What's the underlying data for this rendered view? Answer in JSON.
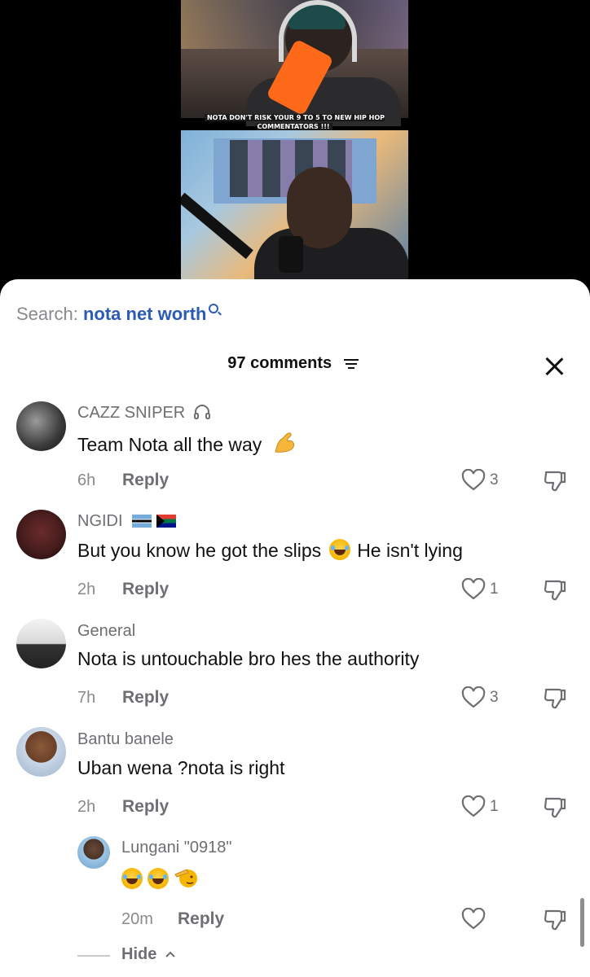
{
  "video": {
    "caption": "NOTA DON'T RISK YOUR 9 TO 5 TO NEW HIP HOP COMMENTATORS !!!"
  },
  "search": {
    "label": "Search:",
    "query": "nota net worth",
    "icon": "search-icon",
    "accent": "#2b5bb5"
  },
  "header": {
    "count": "97 comments",
    "filter_icon": "filter-icon",
    "close_icon": "close-icon"
  },
  "comments": [
    {
      "user": "CAZZ SNIPER",
      "badge": "headphones-icon",
      "text": "Team Nota all the way",
      "emoji": "flexed-biceps",
      "time": "6h",
      "reply": "Reply",
      "likes": "3"
    },
    {
      "user": "NGIDI",
      "badge": "flags-botswana-south-africa",
      "text_a": "But you know he got the slips",
      "emoji": "tears-of-joy",
      "text_b": "He isn't lying",
      "time": "2h",
      "reply": "Reply",
      "likes": "1"
    },
    {
      "user": "General",
      "text": "Nota is untouchable bro hes the authority",
      "time": "7h",
      "reply": "Reply",
      "likes": "3"
    },
    {
      "user": "Bantu banele",
      "text": "Uban wena ?nota is right",
      "time": "2h",
      "reply": "Reply",
      "likes": "1"
    }
  ],
  "nested_reply": {
    "user": "Lungani \"0918\"",
    "emojis": [
      "tears-of-joy",
      "tears-of-joy",
      "saluting-face"
    ],
    "time": "20m",
    "reply": "Reply",
    "likes": ""
  },
  "hide": "Hide"
}
